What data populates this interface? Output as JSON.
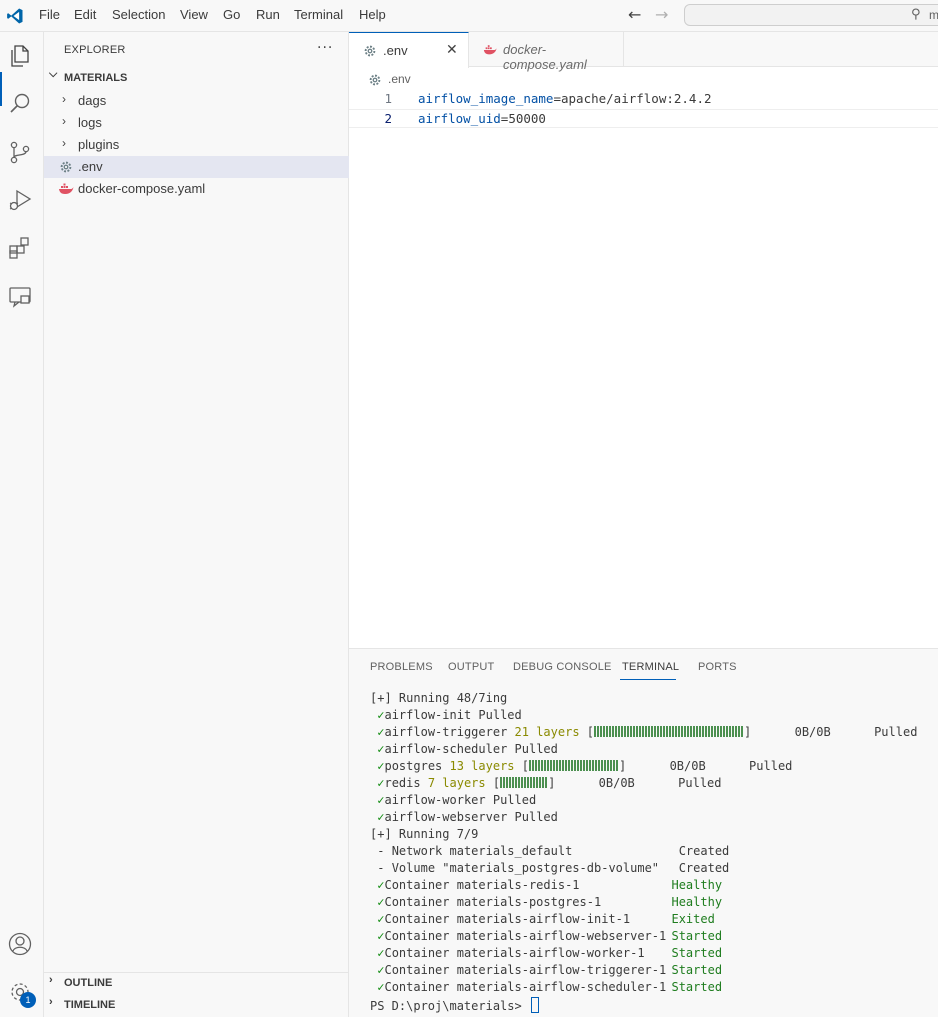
{
  "menu": [
    "File",
    "Edit",
    "Selection",
    "View",
    "Go",
    "Run",
    "Terminal",
    "Help"
  ],
  "command_center": {
    "text": "m"
  },
  "accounts_badge": "1",
  "sidebar": {
    "title": "EXPLORER",
    "more": "···",
    "folder": "MATERIALS",
    "items": [
      {
        "label": "dags"
      },
      {
        "label": "logs"
      },
      {
        "label": "plugins"
      },
      {
        "label": ".env"
      },
      {
        "label": "docker-compose.yaml"
      }
    ],
    "outline": "OUTLINE",
    "timeline": "TIMELINE"
  },
  "tabs": [
    {
      "label": ".env"
    },
    {
      "label": "docker-compose.yaml"
    }
  ],
  "breadcrumb": ".env",
  "code": [
    {
      "num": "1",
      "key": "airflow_image_name",
      "sep": "=",
      "value": "apache/airflow:2.4.2"
    },
    {
      "num": "2",
      "key": "airflow_uid",
      "sep": "=",
      "value": "50000"
    }
  ],
  "panel_tabs": [
    "PROBLEMS",
    "OUTPUT",
    "DEBUG CONSOLE",
    "TERMINAL",
    "PORTS"
  ],
  "terminal": {
    "running1": "[+] Running 48/7ing",
    "pulls": [
      {
        "name": "airflow-init",
        "status": "Pulled"
      },
      {
        "name": "airflow-triggerer",
        "layers": "21 layers",
        "size": "0B/0B",
        "status": "Pulled"
      },
      {
        "name": "airflow-scheduler",
        "status": "Pulled"
      },
      {
        "name": "postgres",
        "layers": "13 layers",
        "size": "0B/0B",
        "status": "Pulled"
      },
      {
        "name": "redis",
        "layers": "7 layers",
        "size": "0B/0B",
        "status": "Pulled"
      },
      {
        "name": "airflow-worker",
        "status": "Pulled"
      },
      {
        "name": "airflow-webserver",
        "status": "Pulled"
      }
    ],
    "running2": "[+] Running 7/9",
    "resources": [
      {
        "mark": "-",
        "name": "Network materials_default",
        "status": "Created"
      },
      {
        "mark": "-",
        "name": "Volume \"materials_postgres-db-volume\"",
        "status": "Created"
      },
      {
        "mark": "✓",
        "name": "Container materials-redis-1",
        "status": "Healthy"
      },
      {
        "mark": "✓",
        "name": "Container materials-postgres-1",
        "status": "Healthy"
      },
      {
        "mark": "✓",
        "name": "Container materials-airflow-init-1",
        "status": "Exited"
      },
      {
        "mark": "✓",
        "name": "Container materials-airflow-webserver-1",
        "status": "Started"
      },
      {
        "mark": "✓",
        "name": "Container materials-airflow-worker-1",
        "status": "Started"
      },
      {
        "mark": "✓",
        "name": "Container materials-airflow-triggerer-1",
        "status": "Started"
      },
      {
        "mark": "✓",
        "name": "Container materials-airflow-scheduler-1",
        "status": "Started"
      }
    ],
    "prompt": "PS D:\\proj\\materials>"
  },
  "colors": {
    "accent": "#005fb8",
    "ok": "#0f8a0f",
    "key": "#0451a5"
  }
}
